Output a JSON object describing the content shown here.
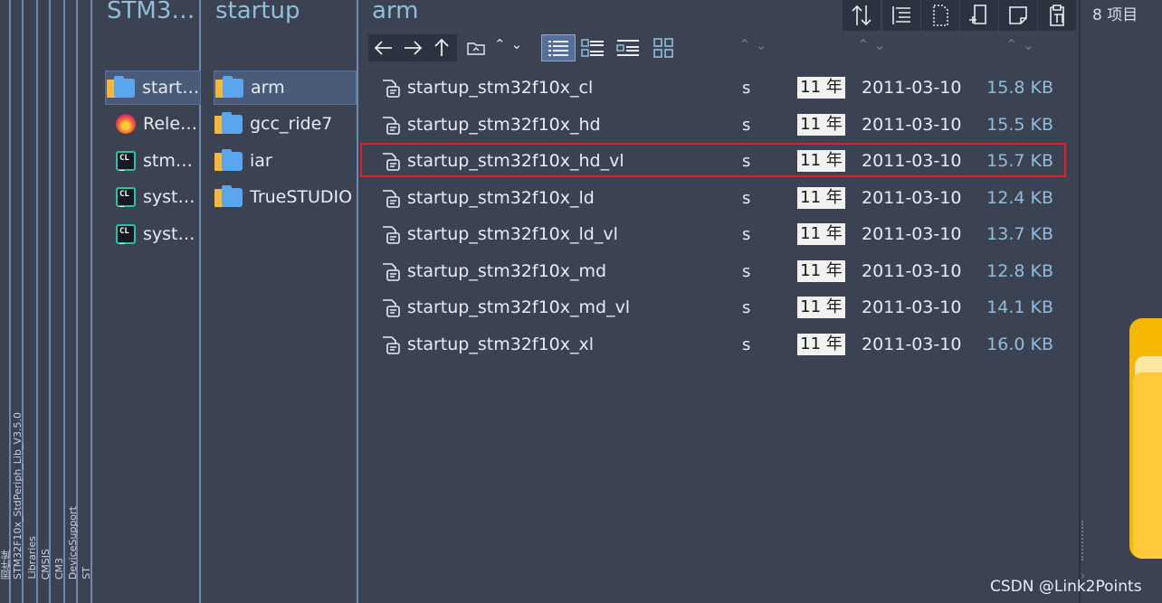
{
  "breadcrumb_strips": [
    "固件库",
    "STM32F10x_StdPeriph_Lib_V3.5.0",
    "Libraries",
    "CMSIS",
    "CM3",
    "DeviceSupport",
    "ST"
  ],
  "columns": {
    "col1": {
      "title": "STM3…",
      "items": [
        {
          "label": "start…",
          "icon": "folder-icon",
          "selected": true
        },
        {
          "label": "Rele…",
          "icon": "firefox-icon"
        },
        {
          "label": "stm…",
          "icon": "clion-icon"
        },
        {
          "label": "syst…",
          "icon": "clion-icon"
        },
        {
          "label": "syst…",
          "icon": "clion-icon"
        }
      ]
    },
    "col2": {
      "title": "startup",
      "items": [
        {
          "label": "arm",
          "icon": "folder-icon",
          "selected": true
        },
        {
          "label": "gcc_ride7",
          "icon": "folder-icon"
        },
        {
          "label": "iar",
          "icon": "folder-icon"
        },
        {
          "label": "TrueSTUDIO",
          "icon": "folder-icon"
        }
      ]
    }
  },
  "main": {
    "title": "arm",
    "item_count": "8 项目",
    "files": [
      {
        "name": "startup_stm32f10x_cl",
        "ext": "s",
        "age": "11 年",
        "date": "2011-03-10",
        "size": "15.8 KB"
      },
      {
        "name": "startup_stm32f10x_hd",
        "ext": "s",
        "age": "11 年",
        "date": "2011-03-10",
        "size": "15.5 KB"
      },
      {
        "name": "startup_stm32f10x_hd_vl",
        "ext": "s",
        "age": "11 年",
        "date": "2011-03-10",
        "size": "15.7 KB",
        "highlighted": true
      },
      {
        "name": "startup_stm32f10x_ld",
        "ext": "s",
        "age": "11 年",
        "date": "2011-03-10",
        "size": "12.4 KB"
      },
      {
        "name": "startup_stm32f10x_ld_vl",
        "ext": "s",
        "age": "11 年",
        "date": "2011-03-10",
        "size": "13.7 KB"
      },
      {
        "name": "startup_stm32f10x_md",
        "ext": "s",
        "age": "11 年",
        "date": "2011-03-10",
        "size": "12.8 KB"
      },
      {
        "name": "startup_stm32f10x_md_vl",
        "ext": "s",
        "age": "11 年",
        "date": "2011-03-10",
        "size": "14.1 KB"
      },
      {
        "name": "startup_stm32f10x_xl",
        "ext": "s",
        "age": "11 年",
        "date": "2011-03-10",
        "size": "16.0 KB"
      }
    ]
  },
  "watermark": "CSDN @Link2Points",
  "colors": {
    "background": "#3b4251",
    "accent": "#8fbfdd",
    "highlight": "#e0202a",
    "selection": "#4a5b7a"
  }
}
